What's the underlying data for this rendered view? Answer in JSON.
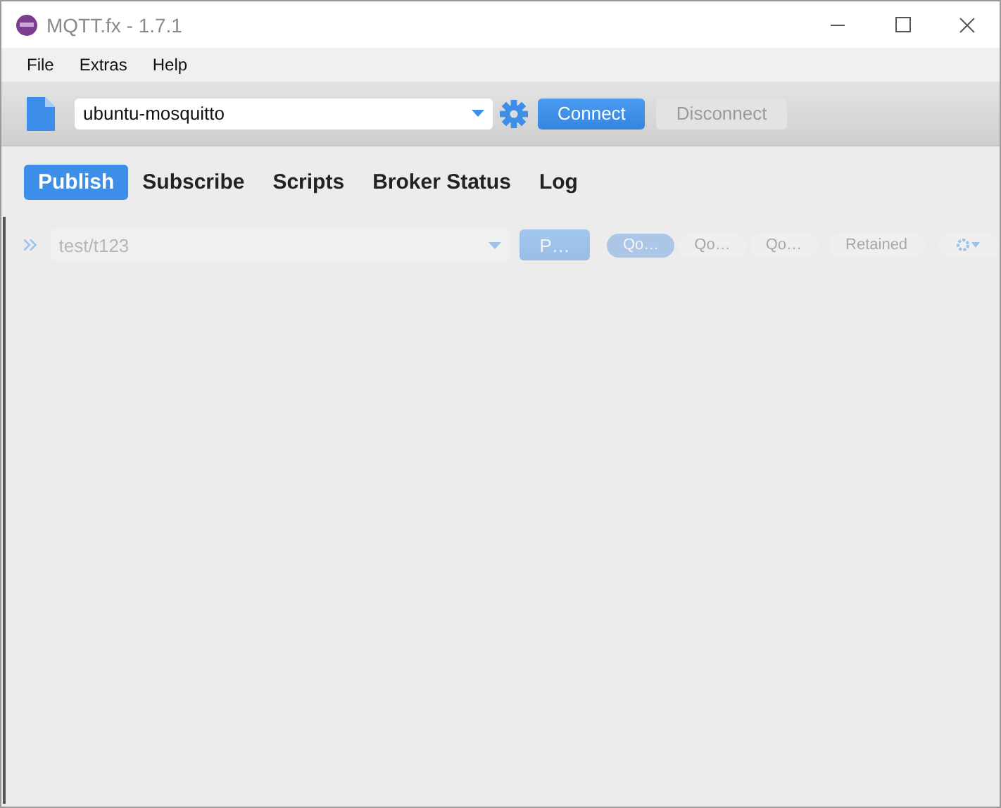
{
  "window": {
    "title": "MQTT.fx - 1.7.1"
  },
  "menu": [
    {
      "label": "File"
    },
    {
      "label": "Extras"
    },
    {
      "label": "Help"
    }
  ],
  "toolbar": {
    "profile": "ubuntu-mosquitto",
    "connect": {
      "label": "Connect",
      "disabled": false
    },
    "disconnect": {
      "label": "Disconnect",
      "disabled": true
    }
  },
  "tabs": [
    {
      "label": "Publish",
      "selected": true
    },
    {
      "label": "Subscribe",
      "selected": false
    },
    {
      "label": "Scripts",
      "selected": false
    },
    {
      "label": "Broker Status",
      "selected": false
    },
    {
      "label": "Log",
      "selected": false
    }
  ],
  "publish": {
    "disabled": true,
    "topic": "test/t123",
    "publish_button": "P…",
    "qos": [
      {
        "label": "Qo…",
        "selected": true
      },
      {
        "label": "Qo…",
        "selected": false
      },
      {
        "label": "Qo…",
        "selected": false
      }
    ],
    "retained": {
      "label": "Retained",
      "selected": false
    }
  }
}
